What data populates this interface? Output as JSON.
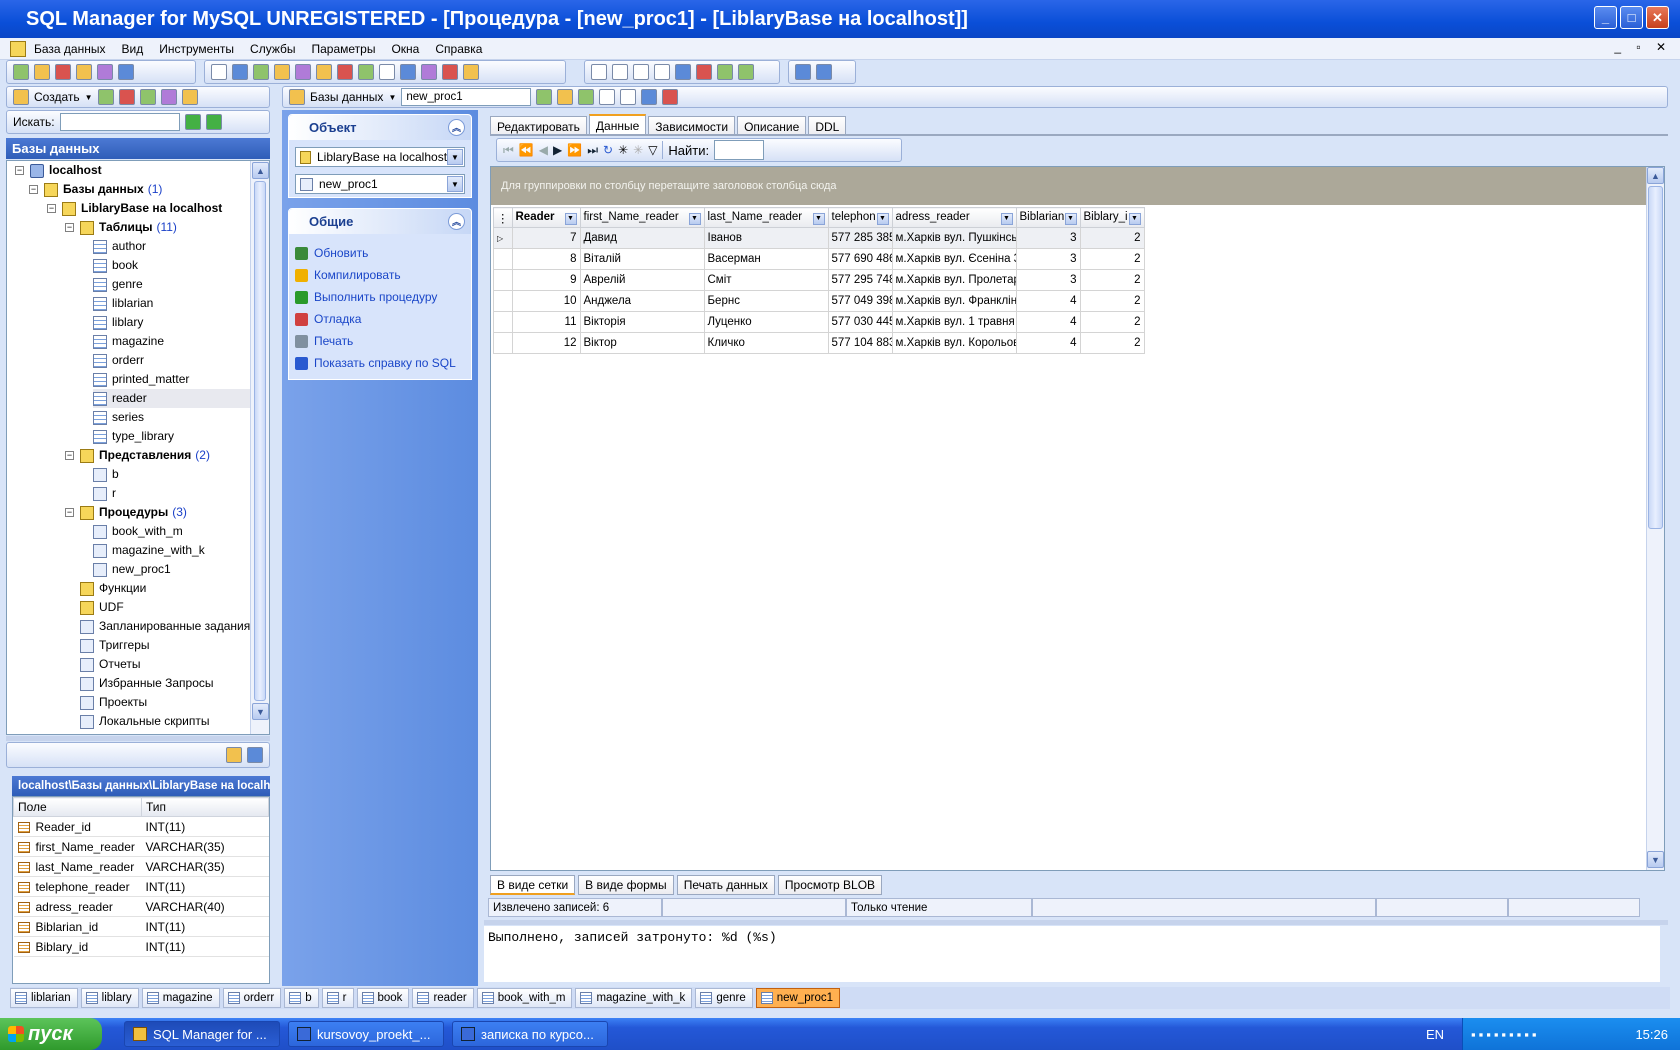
{
  "window": {
    "title": "SQL Manager for MySQL UNREGISTERED - [Процедура - [new_proc1] - [LiblaryBase на localhost]]"
  },
  "menu": [
    "База данных",
    "Вид",
    "Инструменты",
    "Службы",
    "Параметры",
    "Окна",
    "Справка"
  ],
  "left_toolbar": {
    "create_label": "Создать",
    "search_label": "Искать:"
  },
  "db_toolbar": {
    "databases_label": "Базы данных",
    "proc_combo": "new_proc1"
  },
  "db_explorer": {
    "title": "Базы данных",
    "tree": [
      {
        "label": "localhost",
        "bold": true,
        "level": 0,
        "icon": "server-icon"
      },
      {
        "label": "Базы данных",
        "count": "(1)",
        "bold": true,
        "level": 1,
        "icon": "database-folder-icon"
      },
      {
        "label": "LiblaryBase на localhost",
        "bold": true,
        "level": 2,
        "icon": "database-icon"
      },
      {
        "label": "Таблицы",
        "count": "(11)",
        "bold": true,
        "level": 3,
        "icon": "tables-folder-icon"
      },
      {
        "label": "author",
        "level": 4,
        "icon": "table-icon"
      },
      {
        "label": "book",
        "level": 4,
        "icon": "table-icon"
      },
      {
        "label": "genre",
        "level": 4,
        "icon": "table-icon"
      },
      {
        "label": "liblarian",
        "level": 4,
        "icon": "table-icon"
      },
      {
        "label": "liblary",
        "level": 4,
        "icon": "table-icon"
      },
      {
        "label": "magazine",
        "level": 4,
        "icon": "table-icon"
      },
      {
        "label": "orderr",
        "level": 4,
        "icon": "table-icon"
      },
      {
        "label": "printed_matter",
        "level": 4,
        "icon": "table-icon"
      },
      {
        "label": "reader",
        "level": 4,
        "icon": "table-icon",
        "selected": true
      },
      {
        "label": "series",
        "level": 4,
        "icon": "table-icon"
      },
      {
        "label": "type_library",
        "level": 4,
        "icon": "table-icon"
      },
      {
        "label": "Представления",
        "count": "(2)",
        "bold": true,
        "level": 3,
        "icon": "views-folder-icon"
      },
      {
        "label": "b",
        "level": 4,
        "icon": "view-icon"
      },
      {
        "label": "r",
        "level": 4,
        "icon": "view-icon"
      },
      {
        "label": "Процедуры",
        "count": "(3)",
        "bold": true,
        "level": 3,
        "icon": "procedures-folder-icon"
      },
      {
        "label": "book_with_m",
        "level": 4,
        "icon": "procedure-icon"
      },
      {
        "label": "magazine_with_k",
        "level": 4,
        "icon": "procedure-icon"
      },
      {
        "label": "new_proc1",
        "level": 4,
        "icon": "procedure-icon"
      },
      {
        "label": "Функции",
        "level": 3,
        "icon": "functions-folder-icon"
      },
      {
        "label": "UDF",
        "level": 3,
        "icon": "udf-folder-icon"
      },
      {
        "label": "Запланированные задания",
        "level": 3,
        "icon": "scheduled-tasks-icon"
      },
      {
        "label": "Триггеры",
        "level": 3,
        "icon": "triggers-icon"
      },
      {
        "label": "Отчеты",
        "level": 3,
        "icon": "reports-icon"
      },
      {
        "label": "Избранные Запросы",
        "level": 3,
        "icon": "favorites-icon"
      },
      {
        "label": "Проекты",
        "level": 3,
        "icon": "projects-icon"
      },
      {
        "label": "Локальные скрипты",
        "level": 3,
        "icon": "local-scripts-icon"
      }
    ]
  },
  "field_panel": {
    "path": "localhost\\Базы данных\\LiblaryBase на localhost",
    "headers": [
      "Поле",
      "Тип"
    ],
    "rows": [
      [
        "Reader_id",
        "INT(11)"
      ],
      [
        "first_Name_reader",
        "VARCHAR(35)"
      ],
      [
        "last_Name_reader",
        "VARCHAR(35)"
      ],
      [
        "telephone_reader",
        "INT(11)"
      ],
      [
        "adress_reader",
        "VARCHAR(40)"
      ],
      [
        "Biblarian_id",
        "INT(11)"
      ],
      [
        "Biblary_id",
        "INT(11)"
      ]
    ]
  },
  "nav_panel": {
    "object_title": "Объект",
    "db_combo": "LiblaryBase на localhost",
    "proc_combo": "new_proc1",
    "general_title": "Общие",
    "links": [
      {
        "label": "Обновить",
        "icon": "refresh-icon",
        "color": "#3a8a3a"
      },
      {
        "label": "Компилировать",
        "icon": "compile-icon",
        "color": "#f0b000"
      },
      {
        "label": "Выполнить процедуру",
        "icon": "run-icon",
        "color": "#2a9a2a"
      },
      {
        "label": "Отладка",
        "icon": "debug-icon",
        "color": "#d04040"
      },
      {
        "label": "Печать",
        "icon": "print-icon",
        "color": "#8090a0"
      },
      {
        "label": "Показать справку по SQL",
        "icon": "help-icon",
        "color": "#2a5ad0"
      }
    ]
  },
  "editor_tabs": [
    "Редактировать",
    "Данные",
    "Зависимости",
    "Описание",
    "DDL"
  ],
  "editor_active_tab": 1,
  "data_toolbar": {
    "find_label": "Найти:"
  },
  "grid": {
    "group_hint": "Для группировки по столбцу перетащите заголовок столбца сюда",
    "columns": [
      "Reader",
      "first_Name_reader",
      "last_Name_reader",
      "telephon",
      "adress_reader",
      "Biblarian",
      "Biblary_i"
    ],
    "rows": [
      [
        "7",
        "Давид",
        "Іванов",
        "577 285 385",
        "м.Харків вул. Пушкінсь",
        "3",
        "2"
      ],
      [
        "8",
        "Віталій",
        "Васерман",
        "577 690 486",
        "м.Харків вул. Єсеніна 3",
        "3",
        "2"
      ],
      [
        "9",
        "Аврелій",
        "Сміт",
        "577 295 748",
        "м.Харків вул. Пролетар",
        "3",
        "2"
      ],
      [
        "10",
        "Анджела",
        "Бернс",
        "577 049 398",
        "м.Харків вул. Франкліна",
        "4",
        "2"
      ],
      [
        "11",
        "Вікторія",
        "Луценко",
        "577 030 445",
        "м.Харків вул. 1 травня :",
        "4",
        "2"
      ],
      [
        "12",
        "Віктор",
        "Кличко",
        "577 104 883",
        "м.Харків вул. Корольов",
        "4",
        "2"
      ]
    ]
  },
  "bottom_tabs": [
    "В виде сетки",
    "В виде формы",
    "Печать данных",
    "Просмотр BLOB"
  ],
  "status": {
    "records": "Извлечено записей: 6",
    "mode": "Только чтение"
  },
  "log": "Выполнено, записей затронуто: %d (%s)",
  "window_tabs": [
    "liblarian",
    "liblary",
    "magazine",
    "orderr",
    "b",
    "r",
    "book",
    "reader",
    "book_with_m",
    "magazine_with_k",
    "genre",
    "new_proc1"
  ],
  "window_tabs_active": 11,
  "taskbar": {
    "start": "пуск",
    "tasks": [
      "SQL Manager for ...",
      "kursovoy_proekt_...",
      "записка по курсо..."
    ],
    "lang": "EN",
    "clock": "15:26"
  }
}
